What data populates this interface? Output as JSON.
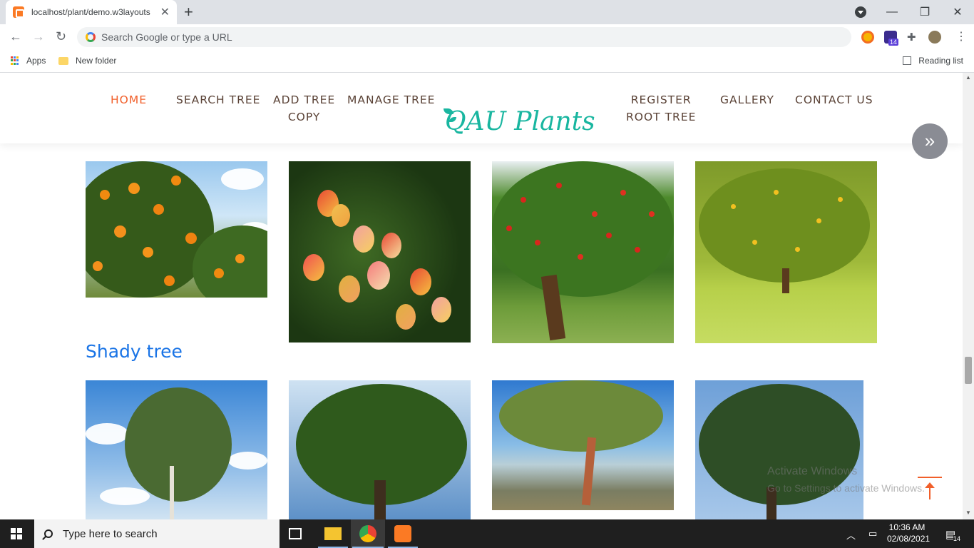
{
  "browser": {
    "tab_title": "localhost/plant/demo.w3layouts",
    "omnibox_placeholder": "Search Google or type a URL",
    "bookmarks": {
      "apps": "Apps",
      "folder": "New folder",
      "reading_list": "Reading list"
    },
    "extension_badge": "14"
  },
  "site": {
    "logo": "QAU Plants",
    "menu": {
      "home": "HOME",
      "search_tree": "SEARCH TREE",
      "add_tree_line1": "ADD TREE",
      "add_tree_line2": "COPY",
      "manage_tree": "MANAGE TREE",
      "register_line1": "REGISTER",
      "register_line2": "ROOT TREE",
      "gallery": "GALLERY",
      "contact_us": "CONTACT US"
    },
    "next_button": "»",
    "section_title": "Shady tree",
    "colors": {
      "accent": "#f15f2a",
      "menu_text": "#5a4236",
      "logo": "#19b6a0",
      "section_title": "#1a74e6"
    }
  },
  "windows": {
    "watermark_line1": "Activate Windows",
    "watermark_line2": "Go to Settings to activate Windows.",
    "taskbar_search": "Type here to search",
    "time": "10:36 AM",
    "date": "02/08/2021",
    "notification_count": "14"
  }
}
